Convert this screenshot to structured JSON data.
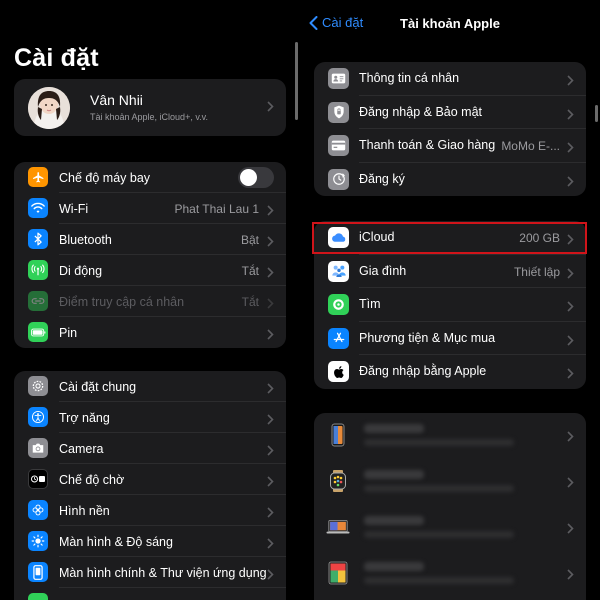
{
  "left": {
    "title": "Cài đặt",
    "profile": {
      "name": "Vân Nhii",
      "subtitle": "Tài khoản Apple, iCloud+, v.v."
    },
    "group1": [
      {
        "label": "Chế độ máy bay",
        "value": "",
        "icon": "airplane-icon",
        "color": "#ff9500",
        "control": "toggle-off"
      },
      {
        "label": "Wi-Fi",
        "value": "Phat Thai Lau 1",
        "icon": "wifi-icon",
        "color": "#0a84ff"
      },
      {
        "label": "Bluetooth",
        "value": "Bật",
        "icon": "bluetooth-icon",
        "color": "#0a84ff"
      },
      {
        "label": "Di động",
        "value": "Tắt",
        "icon": "cellular-icon",
        "color": "#30d158"
      },
      {
        "label": "Điểm truy cập cá nhân",
        "value": "Tắt",
        "icon": "hotspot-icon",
        "color": "#30d158",
        "disabled": true
      },
      {
        "label": "Pin",
        "value": "",
        "icon": "battery-icon",
        "color": "#30d158"
      }
    ],
    "group2": [
      {
        "label": "Cài đặt chung",
        "icon": "gear-icon",
        "color": "#8e8e93"
      },
      {
        "label": "Trợ năng",
        "icon": "accessibility-icon",
        "color": "#0a84ff"
      },
      {
        "label": "Camera",
        "icon": "camera-icon",
        "color": "#8e8e93"
      },
      {
        "label": "Chế độ chờ",
        "icon": "standby-icon",
        "color": "#1c1c1e"
      },
      {
        "label": "Hình nền",
        "icon": "wallpaper-icon",
        "color": "#0a84ff"
      },
      {
        "label": "Màn hình & Độ sáng",
        "icon": "brightness-icon",
        "color": "#0a84ff"
      },
      {
        "label": "Màn hình chính & Thư viện ứng dụng",
        "icon": "home-screen-icon",
        "color": "#0a84ff"
      }
    ]
  },
  "right": {
    "back_label": "Cài đặt",
    "title": "Tài khoản Apple",
    "group1": [
      {
        "label": "Thông tin cá nhân",
        "value": "",
        "icon": "contact-card-icon",
        "color": "#8e8e93"
      },
      {
        "label": "Đăng nhập & Bảo mật",
        "value": "",
        "icon": "shield-icon",
        "color": "#8e8e93"
      },
      {
        "label": "Thanh toán & Giao hàng",
        "value": "MoMo E-...",
        "icon": "credit-card-icon",
        "color": "#8e8e93"
      },
      {
        "label": "Đăng ký",
        "value": "",
        "icon": "subscriptions-icon",
        "color": "#8e8e93"
      }
    ],
    "group2": [
      {
        "label": "iCloud",
        "value": "200 GB",
        "icon": "icloud-icon",
        "color": "#ffffff"
      },
      {
        "label": "Gia đình",
        "value": "Thiết lập",
        "icon": "family-icon",
        "color": "#ffffff"
      },
      {
        "label": "Tìm",
        "value": "",
        "icon": "find-my-icon",
        "color": "#30d158"
      },
      {
        "label": "Phương tiện & Mục mua",
        "value": "",
        "icon": "app-store-icon",
        "color": "#0a84ff"
      },
      {
        "label": "Đăng nhập bằng Apple",
        "value": "",
        "icon": "apple-logo-icon",
        "color": "#ffffff"
      }
    ],
    "devices": [
      {
        "icon": "iphone-device-icon"
      },
      {
        "icon": "watch-device-icon"
      },
      {
        "icon": "macbook-device-icon"
      },
      {
        "icon": "ipad-device-icon"
      }
    ],
    "highlight_color": "#d0141a"
  }
}
